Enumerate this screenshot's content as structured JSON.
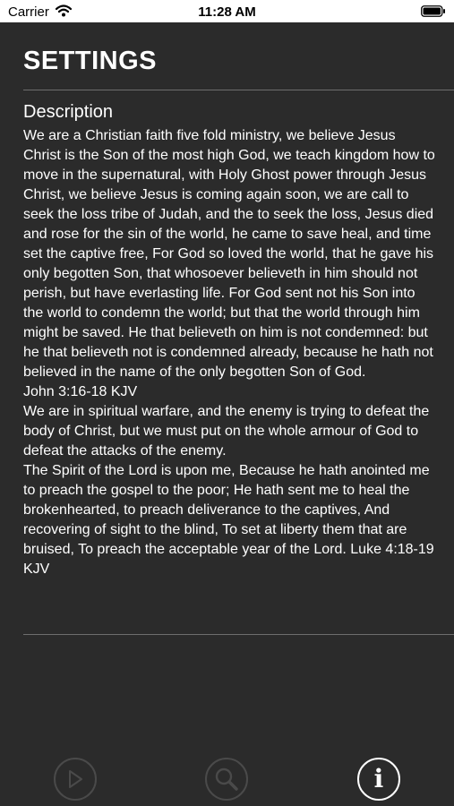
{
  "status_bar": {
    "carrier": "Carrier",
    "time": "11:28 AM",
    "icons": [
      "wifi-icon",
      "battery-icon"
    ]
  },
  "header": {
    "title": "SETTINGS"
  },
  "section": {
    "heading": "Description",
    "paragraphs": [
      "We are a Christian faith five fold ministry, we believe Jesus Christ is the Son of the most high God, we teach kingdom how to move in the supernatural, with Holy Ghost power through Jesus Christ, we believe Jesus is coming again soon, we are call to seek the loss tribe of Judah, and the to seek the loss, Jesus died and rose for the sin of the world, he came to save heal, and time set the captive free, For God so loved the world, that he gave his only begotten Son, that whosoever believeth in him should not perish, but have everlasting life. For God sent not his Son into the world to condemn the world; but that the world through him might be saved. He that believeth on him is not condemned: but he that believeth not is condemned already, because he hath not believed in the name of the only begotten Son of God.",
      "John 3:16-18 KJV",
      "We are in spiritual warfare, and the enemy is trying to defeat the body of Christ, but we must put on the whole armour of God to defeat the attacks of the enemy.",
      "The Spirit of the Lord is upon me, Because he hath anointed me to preach the gospel to the poor; He hath sent me to heal the brokenhearted, to preach deliverance to the captives, And recovering of sight to the blind, To set at liberty them that are bruised, To preach the acceptable year of the Lord. Luke 4:18-19 KJV"
    ]
  },
  "tab_bar": {
    "tabs": [
      {
        "icon": "play-icon",
        "active": false
      },
      {
        "icon": "search-icon",
        "active": false
      },
      {
        "icon": "info-icon",
        "active": true,
        "glyph": "i"
      }
    ]
  },
  "colors": {
    "background": "#2b2b2b",
    "text": "#ffffff",
    "divider": "#6e6e6e",
    "inactive_tab": "#4a4a4a",
    "active_tab": "#ffffff"
  }
}
